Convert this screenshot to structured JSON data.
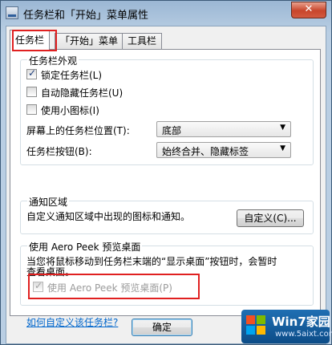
{
  "window": {
    "title": "任务栏和「开始」菜单属性",
    "close_symbol": "✕"
  },
  "tabs": [
    {
      "label": "任务栏",
      "active": true
    },
    {
      "label": "「开始」菜单",
      "active": false
    },
    {
      "label": "工具栏",
      "active": false
    }
  ],
  "appearance": {
    "title": "任务栏外观",
    "lock_taskbar": {
      "label": "锁定任务栏(L)",
      "checked": true
    },
    "auto_hide": {
      "label": "自动隐藏任务栏(U)",
      "checked": false
    },
    "small_icons": {
      "label": "使用小图标(I)",
      "checked": false
    },
    "location": {
      "label": "屏幕上的任务栏位置(T):",
      "value": "底部"
    },
    "buttons": {
      "label": "任务栏按钮(B):",
      "value": "始终合并、隐藏标签"
    }
  },
  "notification": {
    "title": "通知区域",
    "description": "自定义通知区域中出现的图标和通知。",
    "customize_button": "自定义(C)..."
  },
  "aero_peek": {
    "title": "使用 Aero Peek 预览桌面",
    "description_line1": "当您将鼠标移动到任务栏末端的“显示桌面”按钮时，会暂时",
    "description_line2": "查看桌面。",
    "checkbox_label": "使用 Aero Peek 预览桌面(P)",
    "checked": true,
    "disabled": true
  },
  "help_link": "如何自定义该任务栏?",
  "footer": {
    "ok_button": "确定"
  },
  "watermark": {
    "title": "Win7家园",
    "url": "www.5aixt.com"
  },
  "colors": {
    "highlight": "#e02020",
    "link": "#0066cc"
  }
}
